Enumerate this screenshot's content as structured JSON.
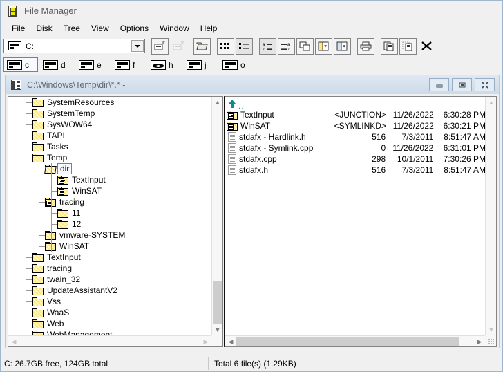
{
  "app": {
    "title": "File Manager",
    "icon": "file-manager-icon"
  },
  "menu": {
    "items": [
      "File",
      "Disk",
      "Tree",
      "View",
      "Options",
      "Window",
      "Help"
    ]
  },
  "toolbar": {
    "drive_combo": {
      "value": "C:",
      "icon": "drive-icon"
    },
    "buttons": [
      {
        "name": "connect-network-drive",
        "icon": "connect-net-icon",
        "state": "framed"
      },
      {
        "name": "disconnect-network-drive",
        "icon": "disconnect-net-icon",
        "state": "disabled"
      },
      {
        "name": "share-as",
        "icon": "share-folder-icon",
        "state": "framed"
      },
      {
        "name": "view-all-file-details",
        "icon": "details-icon",
        "state": "framed"
      },
      {
        "name": "view-name-only",
        "icon": "name-only-icon",
        "state": "pressed"
      },
      {
        "name": "sort-by-name",
        "icon": "sort-az-icon",
        "state": "pressed"
      },
      {
        "name": "sort-by-type",
        "icon": "sort-za-icon",
        "state": "framed"
      },
      {
        "name": "sort-by-size",
        "icon": "sort-size-icon",
        "state": "framed"
      },
      {
        "name": "split-view-1",
        "icon": "window-pair-1-icon",
        "state": "framed"
      },
      {
        "name": "split-view-2",
        "icon": "window-pair-2-icon",
        "state": "framed"
      },
      {
        "name": "print",
        "icon": "printer-icon",
        "state": "framed"
      },
      {
        "name": "copy",
        "icon": "copy-icon",
        "state": "framed"
      },
      {
        "name": "paste",
        "icon": "paste-icon",
        "state": "framed"
      },
      {
        "name": "delete",
        "icon": "delete-x-icon",
        "state": "plain"
      }
    ]
  },
  "drives": [
    {
      "letter": "c",
      "type": "fixed",
      "selected": true
    },
    {
      "letter": "d",
      "type": "fixed",
      "selected": false
    },
    {
      "letter": "e",
      "type": "fixed",
      "selected": false
    },
    {
      "letter": "f",
      "type": "fixed",
      "selected": false
    },
    {
      "letter": "h",
      "type": "cdrom",
      "selected": false
    },
    {
      "letter": "j",
      "type": "fixed",
      "selected": false
    },
    {
      "letter": "o",
      "type": "fixed",
      "selected": false
    }
  ],
  "window": {
    "title": "C:\\Windows\\Temp\\dir\\*.* -",
    "minimize_label": "minimize",
    "restore_label": "restore",
    "close_label": "close"
  },
  "tree": {
    "nodes": [
      {
        "label": "SystemResources",
        "depth": 1,
        "icon": "folder-icon",
        "selected": false
      },
      {
        "label": "SystemTemp",
        "depth": 1,
        "icon": "folder-icon",
        "selected": false
      },
      {
        "label": "SysWOW64",
        "depth": 1,
        "icon": "folder-icon",
        "selected": false
      },
      {
        "label": "TAPI",
        "depth": 1,
        "icon": "folder-icon",
        "selected": false
      },
      {
        "label": "Tasks",
        "depth": 1,
        "icon": "folder-icon",
        "selected": false
      },
      {
        "label": "Temp",
        "depth": 1,
        "icon": "folder-icon",
        "selected": false
      },
      {
        "label": "dir",
        "depth": 2,
        "icon": "folder-open-icon",
        "selected": true
      },
      {
        "label": "TextInput",
        "depth": 3,
        "icon": "folder-link-icon",
        "selected": false
      },
      {
        "label": "WinSAT",
        "depth": 3,
        "icon": "folder-link-icon",
        "selected": false
      },
      {
        "label": "tracing",
        "depth": 2,
        "icon": "folder-link-icon",
        "selected": false
      },
      {
        "label": "11",
        "depth": 3,
        "icon": "folder-icon",
        "selected": false
      },
      {
        "label": "12",
        "depth": 3,
        "icon": "folder-icon",
        "selected": false
      },
      {
        "label": "vmware-SYSTEM",
        "depth": 2,
        "icon": "folder-icon",
        "selected": false
      },
      {
        "label": "WinSAT",
        "depth": 2,
        "icon": "folder-icon",
        "selected": false
      },
      {
        "label": "TextInput",
        "depth": 1,
        "icon": "folder-icon",
        "selected": false
      },
      {
        "label": "tracing",
        "depth": 1,
        "icon": "folder-icon",
        "selected": false
      },
      {
        "label": "twain_32",
        "depth": 1,
        "icon": "folder-icon",
        "selected": false
      },
      {
        "label": "UpdateAssistantV2",
        "depth": 1,
        "icon": "folder-icon",
        "selected": false
      },
      {
        "label": "Vss",
        "depth": 1,
        "icon": "folder-icon",
        "selected": false
      },
      {
        "label": "WaaS",
        "depth": 1,
        "icon": "folder-icon",
        "selected": false
      },
      {
        "label": "Web",
        "depth": 1,
        "icon": "folder-icon",
        "selected": false
      },
      {
        "label": "WebManagement",
        "depth": 1,
        "icon": "folder-icon",
        "selected": false
      }
    ]
  },
  "files": {
    "updir": "..",
    "rows": [
      {
        "name": "TextInput",
        "icon": "folder-link-icon",
        "size": "<JUNCTION>",
        "date": "11/26/2022",
        "time": "6:30:28 PM"
      },
      {
        "name": "WinSAT",
        "icon": "folder-link-icon",
        "size": "<SYMLINKD>",
        "date": "11/26/2022",
        "time": "6:30:21 PM"
      },
      {
        "name": "stdafx - Hardlink.h",
        "icon": "document-icon",
        "size": "516",
        "date": "7/3/2011",
        "time": "8:51:47 AM"
      },
      {
        "name": "stdafx - Symlink.cpp",
        "icon": "document-icon",
        "size": "0",
        "date": "11/26/2022",
        "time": "6:31:01 PM"
      },
      {
        "name": "stdafx.cpp",
        "icon": "document-icon",
        "size": "298",
        "date": "10/1/2011",
        "time": "7:30:26 PM"
      },
      {
        "name": "stdafx.h",
        "icon": "document-icon",
        "size": "516",
        "date": "7/3/2011",
        "time": "8:51:47 AM"
      }
    ]
  },
  "statusbar": {
    "drive_info": "C: 26.7GB free,  124GB total",
    "file_info": "Total 6 file(s) (1.29KB)"
  },
  "colors": {
    "selection_border": "#3c8fdc",
    "folder_yellow": "#ffe97f",
    "window_frame": "#b8cbdd",
    "titlebar_text": "#616b75"
  }
}
